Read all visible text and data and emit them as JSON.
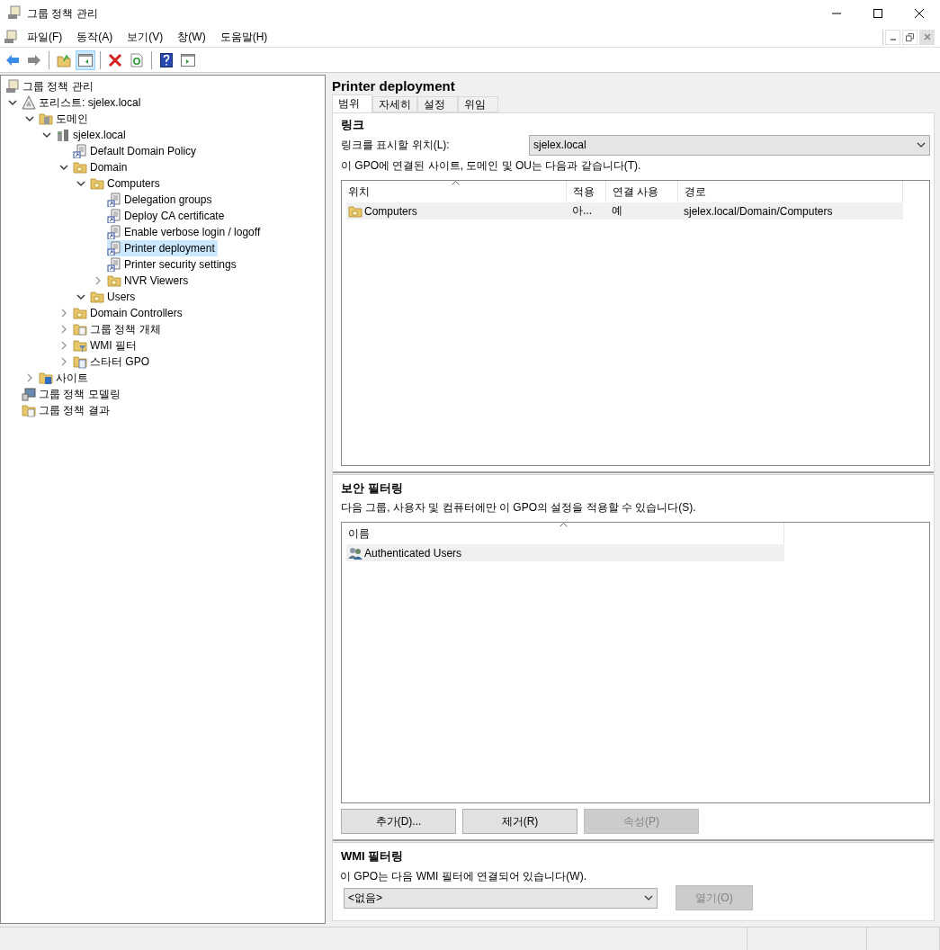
{
  "window": {
    "title": "그룹 정책 관리"
  },
  "menu": [
    "파일(F)",
    "동작(A)",
    "보기(V)",
    "창(W)",
    "도움말(H)"
  ],
  "toolbar": [
    {
      "kind": "back",
      "on": false
    },
    {
      "kind": "forward",
      "on": false
    },
    {
      "kind": "sep"
    },
    {
      "kind": "up",
      "on": false
    },
    {
      "kind": "tree",
      "on": true
    },
    {
      "kind": "sep"
    },
    {
      "kind": "delete",
      "on": false
    },
    {
      "kind": "refresh",
      "on": false
    },
    {
      "kind": "sep"
    },
    {
      "kind": "help",
      "on": false
    },
    {
      "kind": "panel",
      "on": false
    }
  ],
  "tree": [
    {
      "label": "그룹 정책 관리",
      "kind": "root",
      "selected": false,
      "children": [
        {
          "label": "포리스트: sjelex.local",
          "kind": "forest",
          "expanded": true,
          "selected": false,
          "children": [
            {
              "label": "도메인",
              "kind": "domains",
              "expanded": true,
              "selected": false,
              "children": [
                {
                  "label": "sjelex.local",
                  "kind": "domain",
                  "expanded": true,
                  "selected": false,
                  "children": [
                    {
                      "label": "Default Domain Policy",
                      "kind": "gpo",
                      "selected": false
                    },
                    {
                      "label": "Domain",
                      "kind": "ou",
                      "expanded": true,
                      "selected": false,
                      "children": [
                        {
                          "label": "Computers",
                          "kind": "ou",
                          "expanded": true,
                          "selected": false,
                          "children": [
                            {
                              "label": "Delegation groups",
                              "kind": "gpo",
                              "selected": false
                            },
                            {
                              "label": "Deploy CA certificate",
                              "kind": "gpo",
                              "selected": false
                            },
                            {
                              "label": "Enable verbose login / logoff",
                              "kind": "gpo",
                              "selected": false
                            },
                            {
                              "label": "Printer deployment",
                              "kind": "gpo",
                              "selected": true
                            },
                            {
                              "label": "Printer security settings",
                              "kind": "gpo",
                              "selected": false
                            },
                            {
                              "label": "NVR Viewers",
                              "kind": "ou",
                              "expanded": false,
                              "selected": false
                            }
                          ]
                        },
                        {
                          "label": "Users",
                          "kind": "ou",
                          "expanded": true,
                          "selected": false
                        }
                      ]
                    },
                    {
                      "label": "Domain Controllers",
                      "kind": "ou",
                      "expanded": false,
                      "selected": false
                    },
                    {
                      "label": "그룹 정책 개체",
                      "kind": "gpofolder",
                      "expanded": false,
                      "selected": false
                    },
                    {
                      "label": "WMI 필터",
                      "kind": "wmi",
                      "expanded": false,
                      "selected": false
                    },
                    {
                      "label": "스타터 GPO",
                      "kind": "starter",
                      "expanded": false,
                      "selected": false
                    }
                  ]
                }
              ]
            },
            {
              "label": "사이트",
              "kind": "sites",
              "expanded": false,
              "selected": false
            }
          ]
        },
        {
          "label": "그룹 정책 모델링",
          "kind": "modeling",
          "selected": false
        },
        {
          "label": "그룹 정책 결과",
          "kind": "results",
          "selected": false
        }
      ]
    }
  ],
  "detail": {
    "title": "Printer deployment",
    "tabs": [
      {
        "label": "범위",
        "selected": true
      },
      {
        "label": "자세히",
        "selected": false
      },
      {
        "label": "설정",
        "selected": false
      },
      {
        "label": "위임",
        "selected": false
      }
    ],
    "links": {
      "heading": "링크",
      "location_label": "링크를 표시할 위치(L):",
      "location_value": "sjelex.local",
      "description": "이 GPO에 연결된 사이트, 도메인 및 OU는 다음과 같습니다(T).",
      "columns": [
        "위치",
        "적용",
        "연결 사용",
        "경로"
      ],
      "rows": [
        {
          "selected": true,
          "cells": [
            "Computers",
            "아...",
            "예",
            "sjelex.local/Domain/Computers"
          ]
        }
      ]
    },
    "security": {
      "heading": "보안 필터링",
      "description": "다음 그룹, 사용자 및 컴퓨터에만 이 GPO의 설정을 적용할 수 있습니다(S).",
      "columns": [
        "이름"
      ],
      "rows": [
        {
          "selected": true,
          "cells": [
            "Authenticated Users"
          ]
        }
      ],
      "buttons": [
        {
          "label": "추가(D)...",
          "disabled": false
        },
        {
          "label": "제거(R)",
          "disabled": false
        },
        {
          "label": "속성(P)",
          "disabled": true
        }
      ]
    },
    "wmi": {
      "heading": "WMI 필터링",
      "description": "이 GPO는 다음 WMI 필터에 연결되어 있습니다(W).",
      "value": "<없음>",
      "button": {
        "label": "열기(O)",
        "disabled": true
      }
    }
  }
}
